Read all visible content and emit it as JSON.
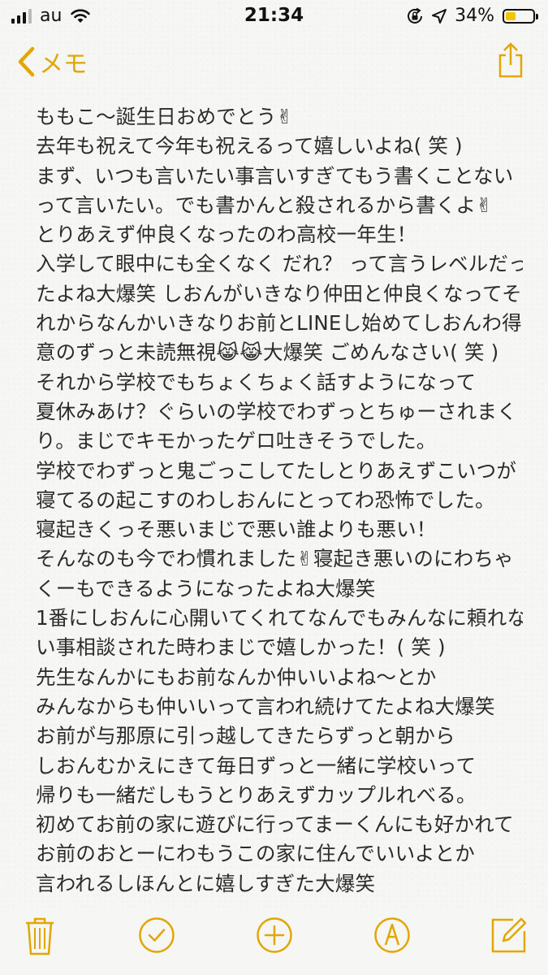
{
  "status_bar": {
    "carrier": "au",
    "time": "21:34",
    "battery_percent_label": "34%",
    "battery_level": 0.34,
    "icons": [
      "signal-icon",
      "wifi-icon",
      "orientation-lock-icon",
      "location-icon",
      "battery-icon"
    ]
  },
  "nav": {
    "back_label": "メモ",
    "share_icon": "share-icon"
  },
  "note": {
    "lines": [
      "ももこ〜誕生日おめでとう✌",
      "去年も祝えて今年も祝えるって嬉しいよね( 笑 )",
      "まず、いつも言いたい事言いすぎてもう書くことない",
      "って言いたい。でも書かんと殺されるから書くよ✌",
      "とりあえず仲良くなったのわ高校一年生！",
      "入学して眼中にも全くなく だれ？ って言うレベルだっ",
      "たよね大爆笑 しおんがいきなり仲田と仲良くなってそ",
      "れからなんかいきなりお前とLINEし始めてしおんわ得",
      "意のずっと未読無視😹😹大爆笑 ごめんなさい( 笑 )",
      "それから学校でもちょくちょく話すようになって",
      "夏休みあけ？ぐらいの学校でわずっとちゅーされまく",
      "り。まじでキモかったゲロ吐きそうでした。",
      "学校でわずっと鬼ごっこしてたしとりあえずこいつが",
      "寝てるの起こすのわしおんにとってわ恐怖でした。",
      "寝起きくっそ悪いまじで悪い誰よりも悪い！",
      "そんなのも今でわ慣れました✌寝起き悪いのにわちゃ",
      "くーもできるようになったよね大爆笑",
      "1番にしおんに心開いてくれてなんでもみんなに頼れな",
      "い事相談された時わまじで嬉しかった！( 笑 )",
      "先生なんかにもお前なんか仲いいよね〜とか",
      "みんなからも仲いいって言われ続けてたよね大爆笑",
      "お前が与那原に引っ越してきたらずっと朝から",
      "しおんむかえにきて毎日ずっと一緒に学校いって",
      "帰りも一緒だしもうとりあえずカップルれべる。",
      "初めてお前の家に遊びに行ってまーくんにも好かれて",
      "お前のおとーにわもうこの家に住んでいいよとか",
      "言われるしほんとに嬉しすぎた大爆笑"
    ]
  },
  "toolbar": {
    "buttons": [
      {
        "name": "trash-icon"
      },
      {
        "name": "checklist-icon"
      },
      {
        "name": "add-icon"
      },
      {
        "name": "markup-icon"
      },
      {
        "name": "compose-icon"
      }
    ]
  },
  "colors": {
    "accent": "#e1a600",
    "text": "#2b2b2b",
    "battery_fill": "#f5c400"
  }
}
